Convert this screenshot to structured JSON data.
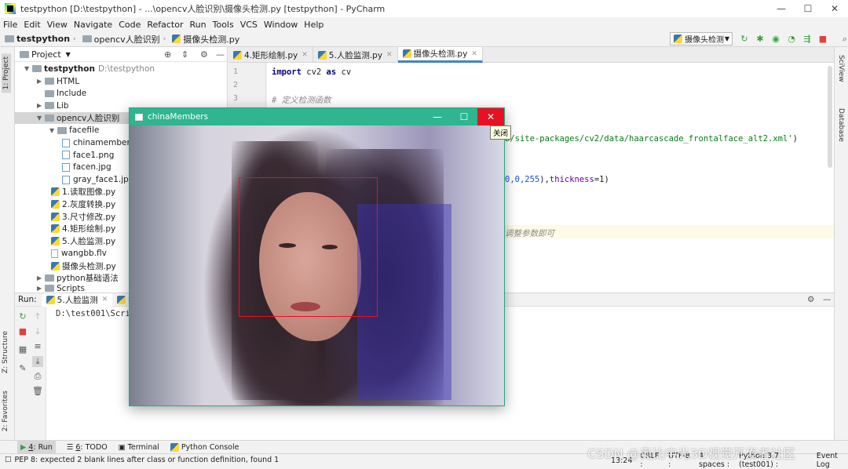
{
  "window": {
    "title": "testpython [D:\\testpython] - ...\\opencv人脸识别\\摄像头检测.py [testpython] - PyCharm"
  },
  "menu": [
    "File",
    "Edit",
    "View",
    "Navigate",
    "Code",
    "Refactor",
    "Run",
    "Tools",
    "VCS",
    "Window",
    "Help"
  ],
  "breadcrumb": [
    "testpython",
    "opencv人脸识别",
    "摄像头检测.py"
  ],
  "run_config": "摄像头检测",
  "left_strip": {
    "project": "1: Project",
    "structure": "Z: Structure",
    "favorites": "2: Favorites"
  },
  "right_strip": {
    "sciview": "SciView",
    "database": "Database"
  },
  "project_panel": {
    "header": "Project",
    "rows": [
      {
        "label": "testpython",
        "extra": "D:\\testpython"
      },
      {
        "label": "HTML"
      },
      {
        "label": "Include"
      },
      {
        "label": "Lib"
      },
      {
        "label": "opencv人脸识别"
      },
      {
        "label": "facefile"
      },
      {
        "label": "chinamembers.jpg"
      },
      {
        "label": "face1.png"
      },
      {
        "label": "facen.jpg"
      },
      {
        "label": "gray_face1.jpg"
      },
      {
        "label": "1.读取图像.py"
      },
      {
        "label": "2.灰度转换.py"
      },
      {
        "label": "3.尺寸修改.py"
      },
      {
        "label": "4.矩形绘制.py"
      },
      {
        "label": "5.人脸监测.py"
      },
      {
        "label": "wangbb.flv"
      },
      {
        "label": "摄像头检测.py"
      },
      {
        "label": "python基础语法"
      },
      {
        "label": "Scripts"
      }
    ]
  },
  "editor": {
    "tabs": [
      "4.矩形绘制.py",
      "5.人脸监测.py",
      "摄像头检测.py"
    ],
    "line_numbers": [
      "1",
      "2",
      "3"
    ],
    "code": {
      "l1_kw1": "import",
      "l1_mod": " cv2 ",
      "l1_kw2": "as",
      "l1_alias": " cv",
      "l3_comment": "# 定义检测函数",
      "cascade_path": "b/site-packages/cv2/data/haarcascade_frontalface_alt2.xml'",
      "cascade_close": ")",
      "rect_nums": "0,0,255",
      "rect_param": "thickness",
      "rect_tail": "=1)",
      "comment_tail": "调整参数即可"
    }
  },
  "run_panel": {
    "label": "Run:",
    "tabs": [
      "5.人脸监测",
      "摄"
    ],
    "console_line": "D:\\test001\\Scrip"
  },
  "bottom_tabs": [
    {
      "num": "4",
      "label": ": Run"
    },
    {
      "num": "6",
      "label": ": TODO"
    },
    {
      "num": "",
      "label": "Terminal"
    },
    {
      "num": "",
      "label": "Python Console"
    }
  ],
  "statusbar": {
    "message": "PEP 8: expected 2 blank lines after class or function definition, found 1",
    "position": "13:24",
    "line_sep": "CRLF :",
    "encoding": "UTF-8 :",
    "indent": "4 spaces :",
    "interpreter": "Python 3.7 (test001) :",
    "event_log": "Event Log"
  },
  "cv_window": {
    "title": "chinaMembers",
    "tooltip": "关闭"
  },
  "watermark": "CSDN @奥比中光3D视觉开发者社区",
  "colors": {
    "accent": "#4083c9",
    "cv_title": "#2fb58f",
    "close_red": "#e81123",
    "detect_box": "#e81123"
  }
}
